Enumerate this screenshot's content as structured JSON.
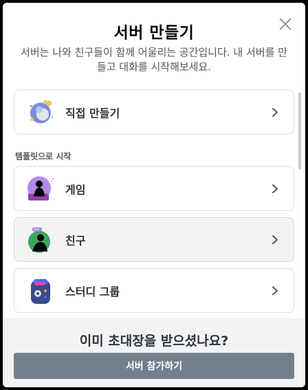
{
  "modal": {
    "title": "서버 만들기",
    "subtitle": "서버는 나와 친구들이 함께 어울리는 공간입니다. 내 서버를 만들고 대화를 시작해보세요."
  },
  "options": {
    "create_own": {
      "label": "직접 만들기",
      "icon": "globe-icon"
    },
    "section_label": "템플릿으로 시작",
    "templates": [
      {
        "label": "게임",
        "icon": "gaming-icon"
      },
      {
        "label": "친구",
        "icon": "friends-icon"
      },
      {
        "label": "스터디 그룹",
        "icon": "backpack-icon"
      }
    ]
  },
  "footer": {
    "title": "이미 초대장을 받으셨나요?",
    "join_label": "서버 참가하기"
  },
  "colors": {
    "join_button": "#747f8d",
    "footer_bg": "#f2f3f5",
    "card_border": "#dcdee2"
  }
}
